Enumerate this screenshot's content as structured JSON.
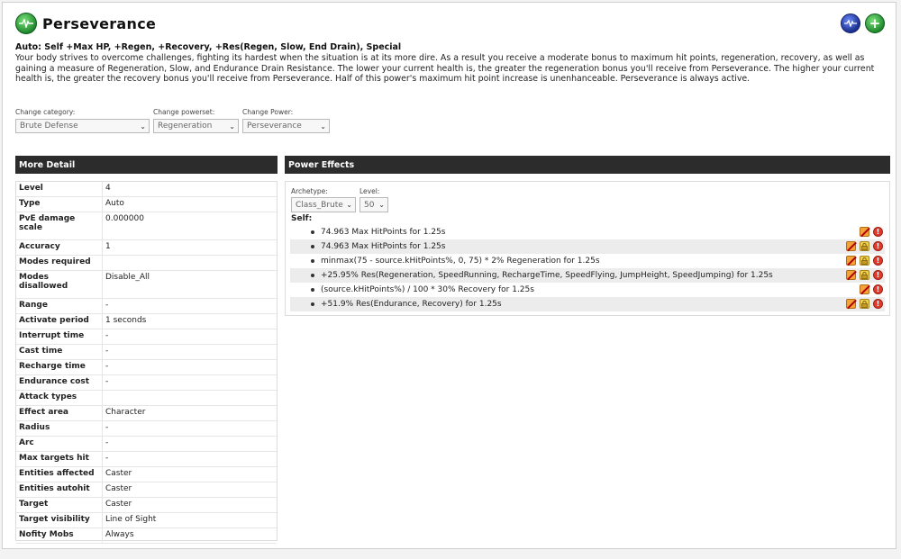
{
  "power": {
    "title": "Perseverance",
    "summary": "Auto: Self +Max HP, +Regen, +Recovery, +Res(Regen, Slow, End Drain), Special",
    "description": "Your body strives to overcome challenges, fighting its hardest when the situation is at its more dire. As a result you receive a moderate bonus to maximum hit points, regeneration, recovery, as well as gaining a measure of Regeneration, Slow, and Endurance Drain Resistance. The lower your current health is, the greater the regeneration bonus you'll receive from Perseverance. The higher your current health is, the greater the recovery bonus you'll receive from Perseverance. Half of this power's maximum hit point increase is unenhanceable. Perseverance is always active."
  },
  "selectors": {
    "category": {
      "label": "Change category:",
      "value": "Brute Defense"
    },
    "powerset": {
      "label": "Change powerset:",
      "value": "Regeneration"
    },
    "power": {
      "label": "Change Power:",
      "value": "Perseverance"
    }
  },
  "more_detail": {
    "title": "More Detail",
    "rows": [
      {
        "key": "Level",
        "value": "4"
      },
      {
        "key": "Type",
        "value": "Auto"
      },
      {
        "key": "PvE damage scale",
        "value": "0.000000"
      },
      {
        "key": "Accuracy",
        "value": "1"
      },
      {
        "key": "Modes required",
        "value": ""
      },
      {
        "key": "Modes disallowed",
        "value": "Disable_All"
      },
      {
        "key": "Range",
        "value": "-"
      },
      {
        "key": "Activate period",
        "value": "1 seconds"
      },
      {
        "key": "Interrupt time",
        "value": "-"
      },
      {
        "key": "Cast time",
        "value": "-"
      },
      {
        "key": "Recharge time",
        "value": "-"
      },
      {
        "key": "Endurance cost",
        "value": "-"
      },
      {
        "key": "Attack types",
        "value": ""
      },
      {
        "key": "Effect area",
        "value": "Character"
      },
      {
        "key": "Radius",
        "value": "-"
      },
      {
        "key": "Arc",
        "value": "-"
      },
      {
        "key": "Max targets hit",
        "value": "-"
      },
      {
        "key": "Entities affected",
        "value": "Caster"
      },
      {
        "key": "Entities autohit",
        "value": "Caster"
      },
      {
        "key": "Target",
        "value": "Caster"
      },
      {
        "key": "Target visibility",
        "value": "Line of Sight"
      },
      {
        "key": "Nofity Mobs",
        "value": "Always"
      }
    ]
  },
  "power_effects": {
    "title": "Power Effects",
    "archetype": {
      "label": "Archetype:",
      "value": "Class_Brute"
    },
    "level": {
      "label": "Level:",
      "value": "50"
    },
    "self_label": "Self:",
    "effects": [
      {
        "text": "74.963 Max HitPoints for 1.25s",
        "lock": false
      },
      {
        "text": "74.963 Max HitPoints for 1.25s",
        "lock": true
      },
      {
        "text": "minmax(75 - source.kHitPoints%, 0, 75) * 2% Regeneration for 1.25s",
        "lock": true
      },
      {
        "text": "+25.95% Res(Regeneration, SpeedRunning, RechargeTime, SpeedFlying, JumpHeight, SpeedJumping) for 1.25s",
        "lock": true
      },
      {
        "text": "(source.kHitPoints%) / 100 * 30% Recovery for 1.25s",
        "lock": false
      },
      {
        "text": "+51.9% Res(Endurance, Recovery) for 1.25s",
        "lock": true
      }
    ]
  },
  "icons": {
    "power": "heartbeat-icon",
    "chart_button": "pulse-chart-icon",
    "add_button": "plus-icon",
    "effect_enhance": "no-enhance-icon",
    "effect_lock": "lock-icon",
    "effect_warn": "warning-icon"
  },
  "colors": {
    "panel_header": "#2c2c2c",
    "accent_green": "#1f8a2e",
    "accent_blue": "#1a2e8c"
  }
}
